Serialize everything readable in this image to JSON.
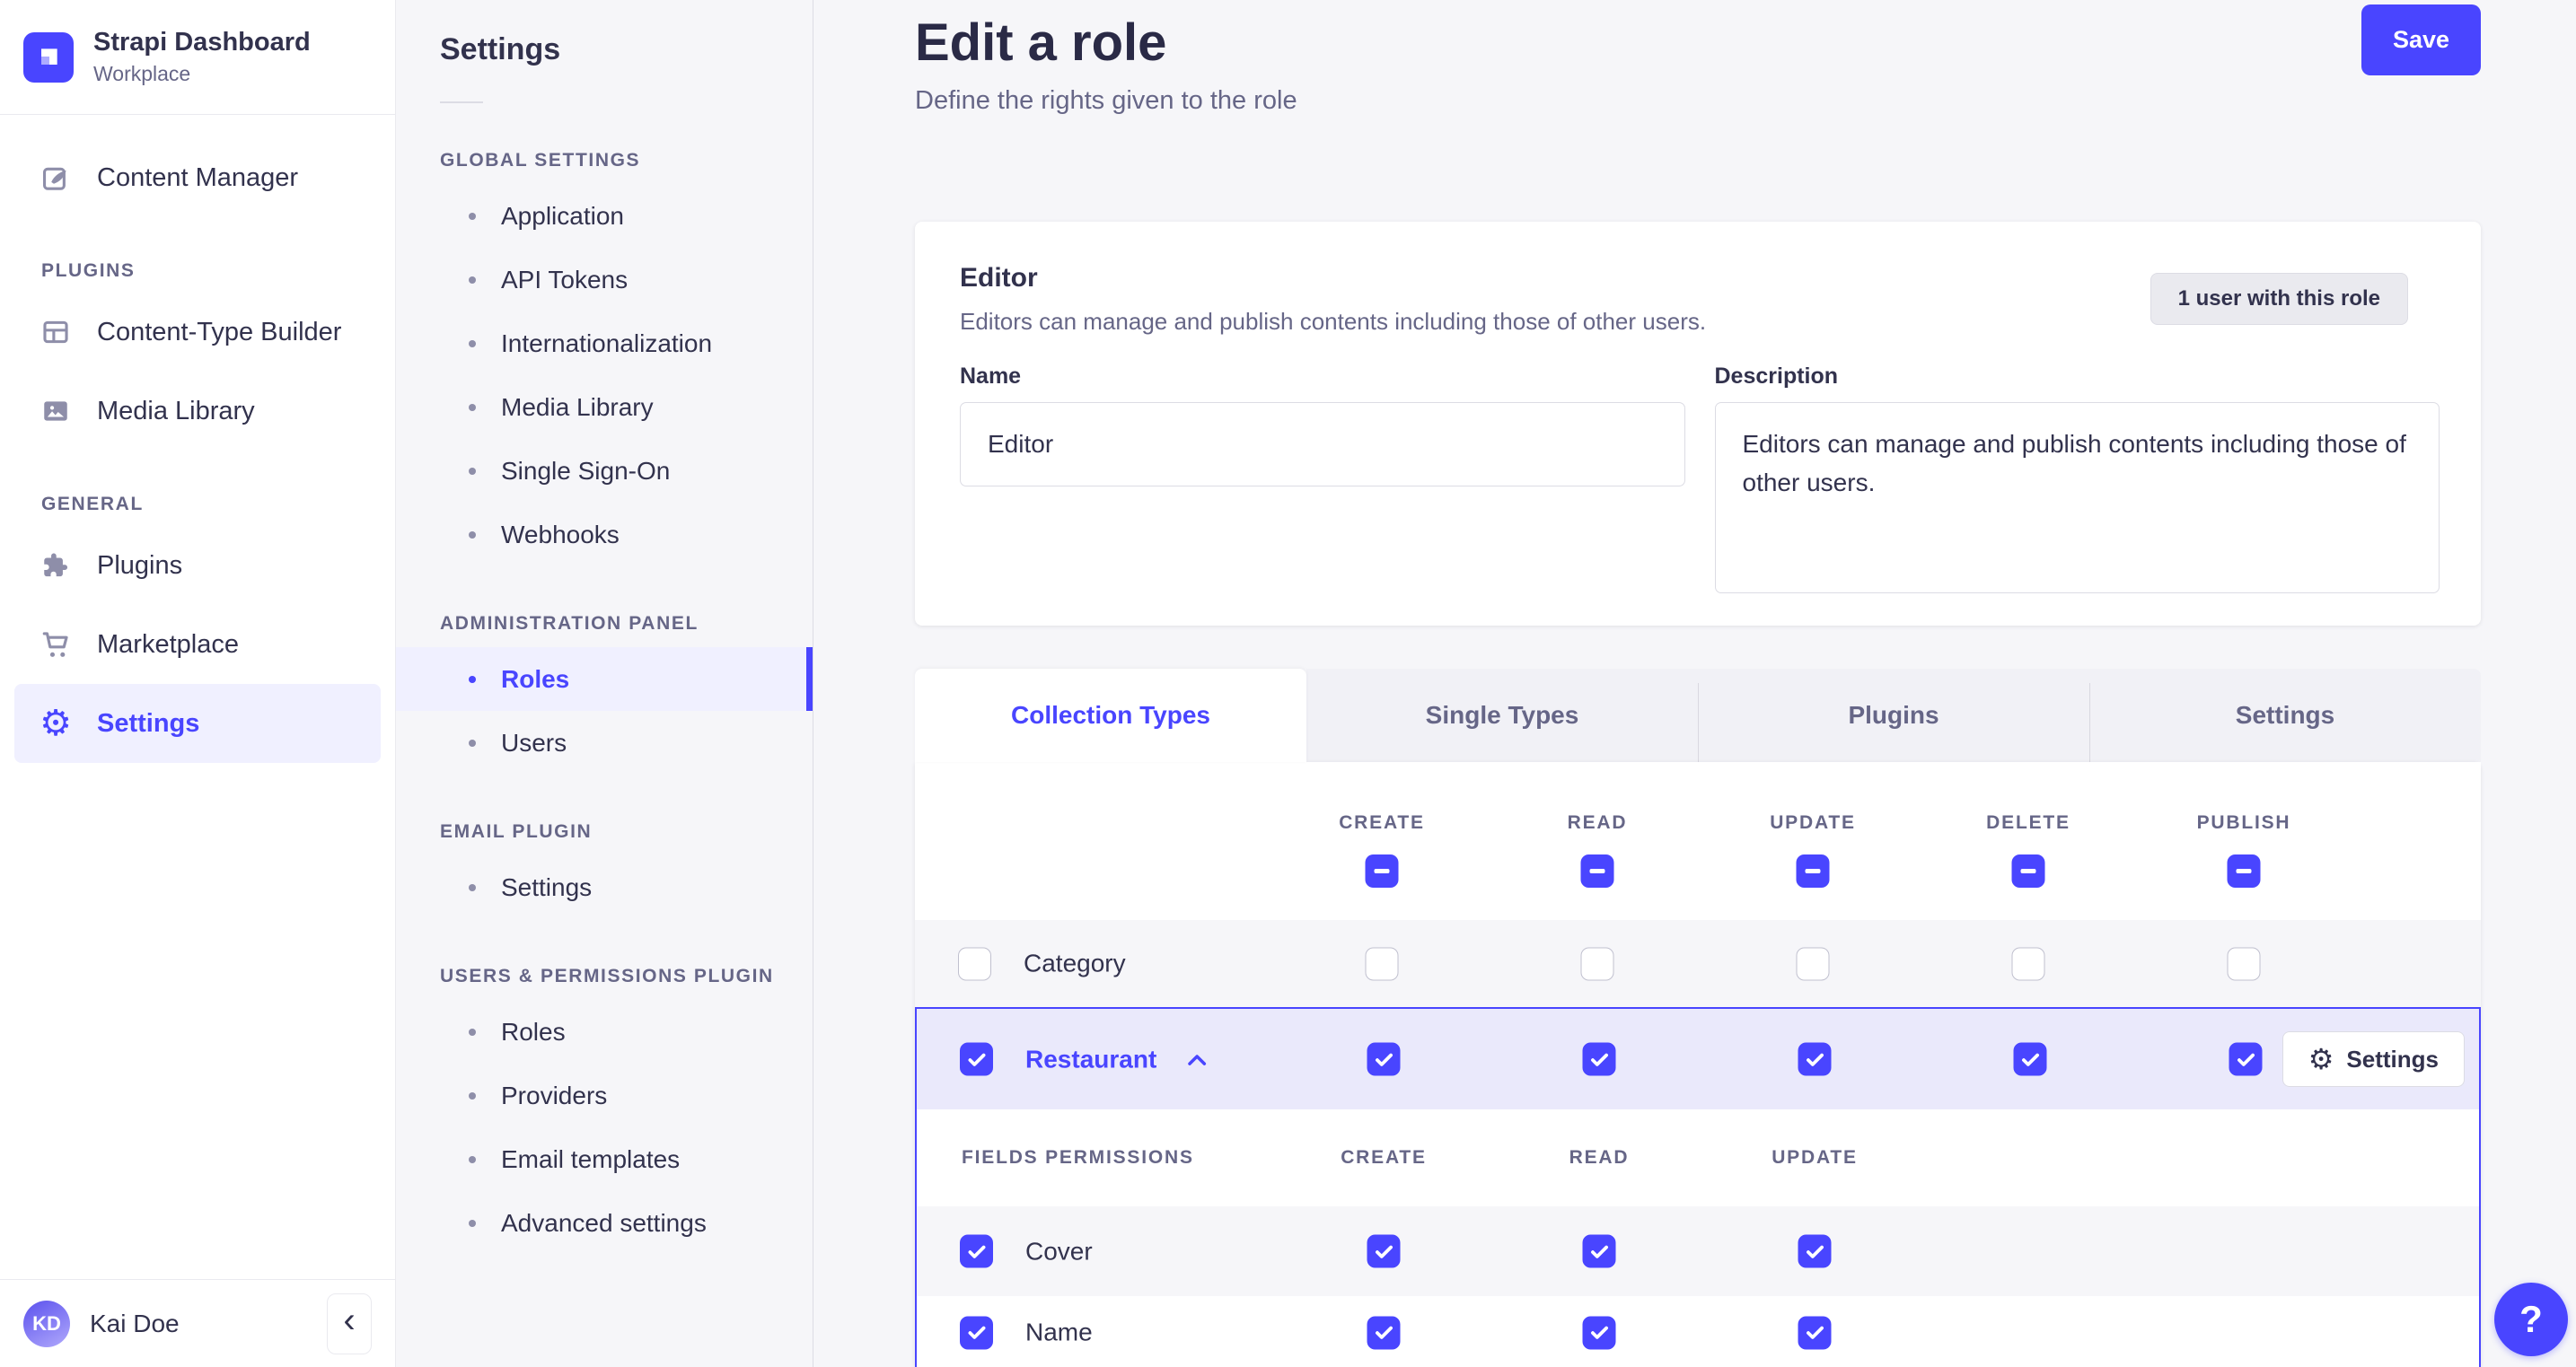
{
  "colors": {
    "primary": "#4945FF",
    "primary_light_bg": "#F0F0FF",
    "selected_row_bg": "#EAE9FB",
    "text": "#32324D",
    "muted": "#666687",
    "page_bg": "#F6F6F9"
  },
  "brand": {
    "title": "Strapi Dashboard",
    "subtitle": "Workplace"
  },
  "sidebar": {
    "content_manager": {
      "icon": "content-manager-icon",
      "label": "Content Manager"
    },
    "sections": [
      {
        "label": "PLUGINS",
        "items": [
          {
            "icon": "content-type-builder-icon",
            "label": "Content-Type Builder"
          },
          {
            "icon": "media-library-icon",
            "label": "Media Library"
          }
        ]
      },
      {
        "label": "GENERAL",
        "items": [
          {
            "icon": "puzzle-icon",
            "label": "Plugins"
          },
          {
            "icon": "cart-icon",
            "label": "Marketplace"
          },
          {
            "icon": "gear-icon",
            "label": "Settings",
            "active": true
          }
        ]
      }
    ],
    "user": {
      "initials": "KD",
      "name": "Kai Doe"
    },
    "collapse_icon": "‹"
  },
  "settings_nav": {
    "title": "Settings",
    "sections": [
      {
        "label": "GLOBAL SETTINGS",
        "items": [
          {
            "label": "Application"
          },
          {
            "label": "API Tokens"
          },
          {
            "label": "Internationalization"
          },
          {
            "label": "Media Library"
          },
          {
            "label": "Single Sign-On"
          },
          {
            "label": "Webhooks"
          }
        ]
      },
      {
        "label": "ADMINISTRATION PANEL",
        "items": [
          {
            "label": "Roles",
            "active": true
          },
          {
            "label": "Users"
          }
        ]
      },
      {
        "label": "EMAIL PLUGIN",
        "items": [
          {
            "label": "Settings"
          }
        ]
      },
      {
        "label": "USERS & PERMISSIONS PLUGIN",
        "items": [
          {
            "label": "Roles"
          },
          {
            "label": "Providers"
          },
          {
            "label": "Email templates"
          },
          {
            "label": "Advanced settings"
          }
        ]
      }
    ]
  },
  "header": {
    "title": "Edit a role",
    "subtitle": "Define the rights given to the role",
    "save_label": "Save"
  },
  "role_card": {
    "title": "Editor",
    "subtitle": "Editors can manage and publish contents including those of other users.",
    "users_button_label": "1 user with this role",
    "name_label": "Name",
    "name_value": "Editor",
    "description_label": "Description",
    "description_value": "Editors can manage and publish contents including those of other users."
  },
  "permissions": {
    "tabs": [
      {
        "label": "Collection Types",
        "active": true
      },
      {
        "label": "Single Types",
        "active": false
      },
      {
        "label": "Plugins",
        "active": false
      },
      {
        "label": "Settings",
        "active": false
      }
    ],
    "columns": [
      "CREATE",
      "READ",
      "UPDATE",
      "DELETE",
      "PUBLISH"
    ],
    "header_checkboxes_state": "indeterminate",
    "rows": [
      {
        "label": "Category",
        "row_checkbox": false,
        "cells": [
          false,
          false,
          false,
          false,
          false
        ],
        "selected": false
      },
      {
        "label": "Restaurant",
        "row_checkbox": true,
        "cells": [
          true,
          true,
          true,
          true,
          true
        ],
        "selected": true,
        "expanded": true,
        "settings_button_label": "Settings"
      }
    ],
    "fields_section": {
      "title": "FIELDS PERMISSIONS",
      "columns": [
        "CREATE",
        "READ",
        "UPDATE"
      ],
      "rows": [
        {
          "label": "Cover",
          "row_checkbox": true,
          "cells": [
            true,
            true,
            true
          ]
        },
        {
          "label": "Name",
          "row_checkbox": true,
          "cells": [
            true,
            true,
            true
          ]
        }
      ]
    }
  },
  "help_button": {
    "label": "?"
  }
}
